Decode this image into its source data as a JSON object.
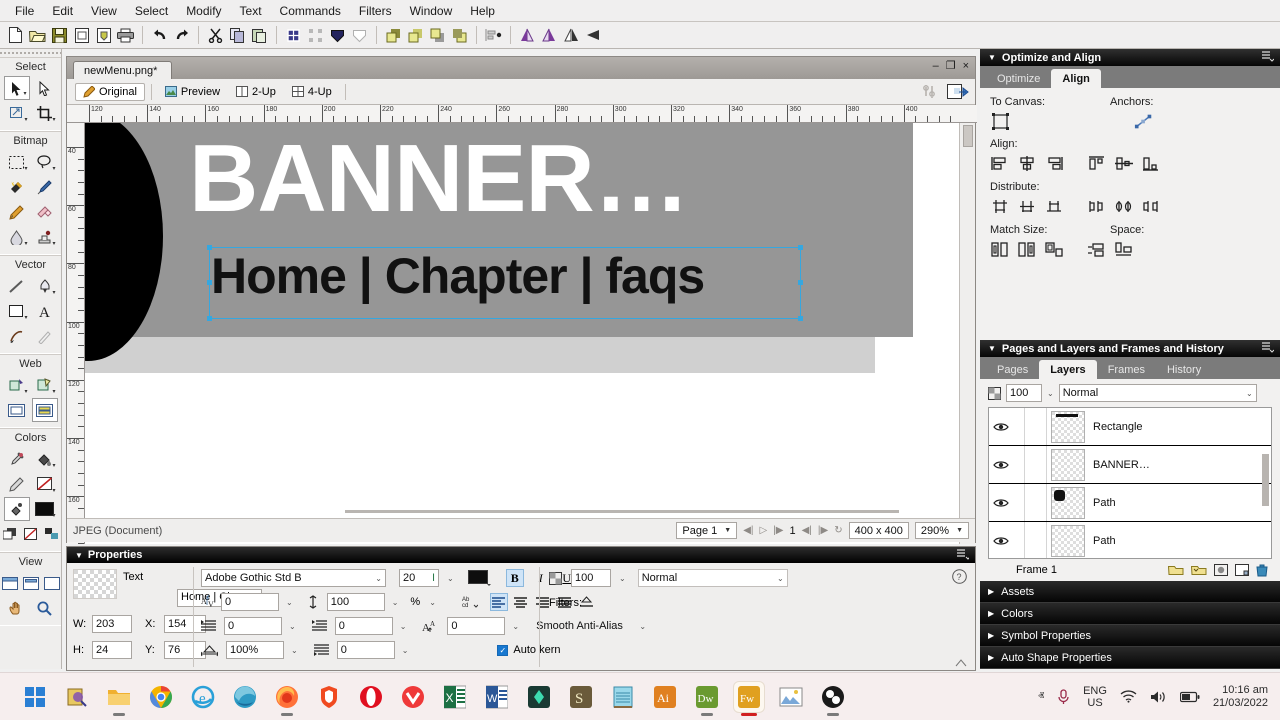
{
  "menubar": {
    "items": [
      "File",
      "Edit",
      "View",
      "Select",
      "Modify",
      "Text",
      "Commands",
      "Filters",
      "Window",
      "Help"
    ]
  },
  "toolbar": {
    "buttons": [
      {
        "name": "new-document-icon",
        "label": "New"
      },
      {
        "name": "open-document-icon",
        "label": "Open"
      },
      {
        "name": "save-document-icon",
        "label": "Save"
      },
      {
        "name": "import-icon",
        "label": "Import"
      },
      {
        "name": "export-icon",
        "label": "Export"
      },
      {
        "name": "print-icon",
        "label": "Print"
      },
      {
        "name": "undo-icon",
        "label": "Undo"
      },
      {
        "name": "redo-icon",
        "label": "Redo"
      },
      {
        "name": "cut-icon",
        "label": "Cut"
      },
      {
        "name": "copy-icon",
        "label": "Copy"
      },
      {
        "name": "paste-icon",
        "label": "Paste"
      },
      {
        "name": "group-icon",
        "label": "Group"
      },
      {
        "name": "ungroup-icon",
        "label": "Ungroup"
      },
      {
        "name": "join-icon",
        "label": "Join"
      },
      {
        "name": "split-icon",
        "label": "Split"
      },
      {
        "name": "bring-to-front-icon",
        "label": "Bring to Front"
      },
      {
        "name": "bring-forward-icon",
        "label": "Bring Forward"
      },
      {
        "name": "send-backward-icon",
        "label": "Send Backward"
      },
      {
        "name": "send-to-back-icon",
        "label": "Send to Back"
      },
      {
        "name": "align-icon",
        "label": "Align"
      },
      {
        "name": "rotate-90-cw-icon",
        "label": "Rotate 90 CW"
      },
      {
        "name": "rotate-90-ccw-icon",
        "label": "Rotate 90 CCW"
      },
      {
        "name": "flip-horizontal-icon",
        "label": "Flip Horizontal"
      },
      {
        "name": "flip-vertical-icon",
        "label": "Flip Vertical"
      }
    ]
  },
  "tools": {
    "sections": [
      {
        "title": "Select",
        "rows": [
          [
            {
              "name": "pointer-tool",
              "label": "Pointer",
              "selected": true,
              "caret": true
            },
            {
              "name": "subselection-tool",
              "label": "Subselection",
              "selected": false,
              "caret": false
            }
          ],
          [
            {
              "name": "scale-tool",
              "label": "Scale",
              "selected": false,
              "caret": true
            },
            {
              "name": "crop-tool",
              "label": "Crop",
              "selected": false,
              "caret": true
            }
          ]
        ]
      },
      {
        "title": "Bitmap",
        "rows": [
          [
            {
              "name": "marquee-tool",
              "label": "Marquee",
              "selected": false,
              "caret": true
            },
            {
              "name": "lasso-tool",
              "label": "Lasso",
              "selected": false,
              "caret": true
            }
          ],
          [
            {
              "name": "magic-wand-tool",
              "label": "Magic Wand",
              "selected": false,
              "caret": false
            },
            {
              "name": "brush-tool",
              "label": "Brush",
              "selected": false,
              "caret": false
            }
          ],
          [
            {
              "name": "pencil-tool",
              "label": "Pencil",
              "selected": false,
              "caret": false
            },
            {
              "name": "eraser-tool",
              "label": "Eraser",
              "selected": false,
              "caret": false
            }
          ],
          [
            {
              "name": "blur-tool",
              "label": "Blur",
              "selected": false,
              "caret": true
            },
            {
              "name": "rubber-stamp-tool",
              "label": "Rubber Stamp",
              "selected": false,
              "caret": true
            }
          ]
        ]
      },
      {
        "title": "Vector",
        "rows": [
          [
            {
              "name": "line-tool",
              "label": "Line",
              "selected": false,
              "caret": false
            },
            {
              "name": "pen-tool",
              "label": "Pen",
              "selected": false,
              "caret": true
            }
          ],
          [
            {
              "name": "rectangle-tool",
              "label": "Rectangle",
              "selected": false,
              "caret": true
            },
            {
              "name": "text-tool",
              "label": "Text",
              "selected": false,
              "caret": false
            }
          ],
          [
            {
              "name": "freeform-tool",
              "label": "Freeform",
              "selected": false,
              "caret": false
            },
            {
              "name": "knife-tool",
              "label": "Knife",
              "selected": false,
              "caret": false
            }
          ]
        ]
      },
      {
        "title": "Web",
        "rows": [
          [
            {
              "name": "slice-tool",
              "label": "Slice",
              "selected": false,
              "caret": true
            },
            {
              "name": "polygon-slice-tool",
              "label": "Polygon Slice",
              "selected": false,
              "caret": true
            }
          ],
          [
            {
              "name": "hide-hotspots-button",
              "label": "Hide Hotspots and Slices",
              "selected": false,
              "caret": false
            },
            {
              "name": "show-hotspots-button",
              "label": "Show Hotspots and Slices",
              "selected": true,
              "caret": false
            }
          ]
        ]
      },
      {
        "title": "Colors",
        "rows": [
          [
            {
              "name": "eyedropper-tool",
              "label": "Eyedropper",
              "selected": false,
              "caret": false
            },
            {
              "name": "paint-bucket-tool",
              "label": "Paint Bucket",
              "selected": false,
              "caret": true
            }
          ],
          [
            {
              "name": "stroke-color-swatch",
              "label": "Stroke Color",
              "selected": false,
              "caret": false
            },
            {
              "name": "fill-color-swatch",
              "label": "Fill Color",
              "selected": false,
              "caret": true
            }
          ],
          [
            {
              "name": "stroke-color-well",
              "label": "Stroke",
              "selected": true,
              "caret": false
            },
            {
              "name": "fill-color-well",
              "label": "Fill",
              "selected": false,
              "caret": true
            }
          ],
          [
            {
              "name": "default-colors-button",
              "label": "Default Colors",
              "selected": false,
              "caret": false
            },
            {
              "name": "no-stroke-or-fill-button",
              "label": "No Stroke or Fill",
              "selected": false,
              "caret": false
            },
            {
              "name": "swap-colors-button",
              "label": "Swap Colors",
              "selected": false,
              "caret": false
            }
          ]
        ]
      },
      {
        "title": "View",
        "rows": [
          [
            {
              "name": "standard-screen-mode-button",
              "label": "Standard Screen Mode",
              "selected": false,
              "caret": false
            },
            {
              "name": "full-screen-with-menus-button",
              "label": "Full Screen with Menus",
              "selected": false,
              "caret": false
            },
            {
              "name": "full-screen-mode-button",
              "label": "Full Screen Mode",
              "selected": false,
              "caret": false
            }
          ],
          [
            {
              "name": "hand-tool",
              "label": "Hand",
              "selected": false,
              "caret": false
            },
            {
              "name": "zoom-tool",
              "label": "Zoom",
              "selected": false,
              "caret": false
            }
          ]
        ]
      }
    ]
  },
  "document": {
    "tab_title": "newMenu.png*",
    "window_buttons": {
      "minimize": "–",
      "restore": "❐",
      "close": "×"
    },
    "view_tabs": [
      {
        "label": "Original",
        "icon": "pencil-icon",
        "active": true
      },
      {
        "label": "Preview",
        "icon": "image-icon",
        "active": false
      },
      {
        "label": "2-Up",
        "icon": "two-up-icon",
        "active": false
      },
      {
        "label": "4-Up",
        "icon": "four-up-icon",
        "active": false
      }
    ],
    "right_icons": [
      {
        "name": "optimize-settings-icon",
        "label": "Optimize"
      },
      {
        "name": "quick-export-icon",
        "label": "Quick Export"
      }
    ],
    "ruler_h_labels": [
      "120",
      "140",
      "160",
      "180",
      "200",
      "220",
      "240",
      "260",
      "280",
      "300",
      "320",
      "340",
      "360",
      "380",
      "400"
    ],
    "ruler_v_labels": [
      "40",
      "60",
      "80",
      "100",
      "120",
      "140",
      "160"
    ],
    "canvas": {
      "banner_text": "BANNER…",
      "nav_text": "Home | Chapter | faqs",
      "banner_bg": "#969696",
      "banner_text_color": "#ffffff",
      "nav_text_color": "#111111",
      "circle_color": "#000000",
      "selection_color": "#35a7e0"
    },
    "status": {
      "doc_type": "JPEG (Document)",
      "page": "Page 1",
      "frame_number": "1",
      "canvas_size": "400 x 400",
      "zoom": "290%"
    }
  },
  "properties": {
    "title": "Properties",
    "object_type": "Text",
    "object_name": "Home | Chap",
    "width_label": "W:",
    "width_value": "203",
    "x_label": "X:",
    "x_value": "154",
    "height_label": "H:",
    "height_value": "24",
    "y_label": "Y:",
    "y_value": "76",
    "font_family": "Adobe Gothic Std B",
    "font_size": "20",
    "kerning": "0",
    "leading": "100",
    "leading_unit": "%",
    "indent": "0",
    "space_before": "0",
    "space_after": "0",
    "baseline_shift": "0",
    "horizontal_scale": "100%",
    "anti_alias": "Smooth Anti-Alias",
    "auto_kern_label": "Auto kern",
    "auto_kern_checked": true,
    "bold_label": "B",
    "italic_label": "I",
    "underline_label": "U",
    "opacity": "100",
    "blend_mode": "Normal",
    "filters_label": "Filters:",
    "fill_color": "#111111"
  },
  "right_panels": {
    "optimize_align": {
      "title": "Optimize and Align",
      "tabs": [
        {
          "label": "Optimize",
          "active": false
        },
        {
          "label": "Align",
          "active": true
        }
      ],
      "to_canvas_label": "To Canvas:",
      "anchors_label": "Anchors:",
      "align_label": "Align:",
      "distribute_label": "Distribute:",
      "match_size_label": "Match Size:",
      "space_label": "Space:",
      "align_icons": [
        "align-left-icon",
        "align-center-horizontal-icon",
        "align-right-icon",
        "align-top-icon",
        "align-middle-vertical-icon",
        "align-bottom-icon"
      ],
      "distribute_icons": [
        "distribute-top-icon",
        "distribute-middle-icon",
        "distribute-bottom-icon",
        "distribute-left-icon",
        "distribute-center-icon",
        "distribute-right-icon"
      ],
      "match_size_icons": [
        "match-width-icon",
        "match-height-icon",
        "match-both-icon"
      ],
      "space_icons": [
        "space-vertical-icon",
        "space-horizontal-icon"
      ]
    },
    "layers_panel": {
      "title": "Pages and Layers and Frames and History",
      "tabs": [
        {
          "label": "Pages",
          "active": false
        },
        {
          "label": "Layers",
          "active": true
        },
        {
          "label": "Frames",
          "active": false
        },
        {
          "label": "History",
          "active": false
        }
      ],
      "opacity": "100",
      "blend_mode": "Normal",
      "rows": [
        {
          "name": "Rectangle",
          "visible": true
        },
        {
          "name": "BANNER…",
          "visible": true
        },
        {
          "name": "Path",
          "visible": true
        },
        {
          "name": "Path",
          "visible": true
        }
      ],
      "footer_label": "Frame 1",
      "footer_icons": [
        "new-sub-layer-icon",
        "new-layer-icon",
        "add-mask-icon",
        "new-bitmap-image-icon",
        "delete-selection-icon"
      ]
    },
    "accordions": [
      {
        "label": "Assets"
      },
      {
        "label": "Colors"
      },
      {
        "label": "Symbol Properties"
      },
      {
        "label": "Auto Shape Properties"
      }
    ]
  },
  "taskbar": {
    "icons": [
      {
        "name": "windows-start-icon",
        "label": "Start",
        "glyph": "",
        "active": false,
        "running": false
      },
      {
        "name": "search-icon",
        "label": "Search",
        "glyph": "",
        "active": false,
        "running": false
      },
      {
        "name": "file-explorer-icon",
        "label": "File Explorer",
        "glyph": "",
        "active": false,
        "running": true
      },
      {
        "name": "chrome-icon",
        "label": "Google Chrome",
        "glyph": "",
        "active": false,
        "running": false
      },
      {
        "name": "internet-explorer-icon",
        "label": "Internet Explorer",
        "glyph": "e",
        "active": false,
        "running": false
      },
      {
        "name": "edge-icon",
        "label": "Microsoft Edge",
        "glyph": "",
        "active": false,
        "running": false
      },
      {
        "name": "firefox-icon",
        "label": "Mozilla Firefox",
        "glyph": "",
        "active": false,
        "running": true
      },
      {
        "name": "brave-icon",
        "label": "Brave",
        "glyph": "",
        "active": false,
        "running": false
      },
      {
        "name": "opera-icon",
        "label": "Opera",
        "glyph": "O",
        "active": false,
        "running": false
      },
      {
        "name": "vivaldi-icon",
        "label": "Vivaldi",
        "glyph": "V",
        "active": false,
        "running": false
      },
      {
        "name": "excel-icon",
        "label": "Microsoft Excel",
        "glyph": "X",
        "active": false,
        "running": false
      },
      {
        "name": "word-icon",
        "label": "Microsoft Word",
        "glyph": "W",
        "active": false,
        "running": false
      },
      {
        "name": "figma-icon",
        "label": "Figma",
        "glyph": "",
        "active": false,
        "running": false
      },
      {
        "name": "substance-icon",
        "label": "Substance",
        "glyph": "S",
        "active": false,
        "running": false
      },
      {
        "name": "notepad-icon",
        "label": "Notepad",
        "glyph": "",
        "active": false,
        "running": false
      },
      {
        "name": "illustrator-icon",
        "label": "Adobe Illustrator",
        "glyph": "Ai",
        "active": false,
        "running": false
      },
      {
        "name": "dreamweaver-icon",
        "label": "Adobe Dreamweaver",
        "glyph": "Dw",
        "active": false,
        "running": true
      },
      {
        "name": "fireworks-icon",
        "label": "Adobe Fireworks",
        "glyph": "Fw",
        "active": true,
        "running": true
      },
      {
        "name": "photos-icon",
        "label": "Photos",
        "glyph": "",
        "active": false,
        "running": false
      },
      {
        "name": "obs-icon",
        "label": "OBS Studio",
        "glyph": "",
        "active": false,
        "running": true
      }
    ],
    "tray": {
      "show_hidden_icons": "ⱏ",
      "microphone": "microphone-icon",
      "language": "ENG",
      "language_region": "US",
      "wifi": "wifi-icon",
      "volume": "volume-icon",
      "battery": "battery-icon",
      "time": "10:16 am",
      "date": "21/03/2022"
    }
  }
}
